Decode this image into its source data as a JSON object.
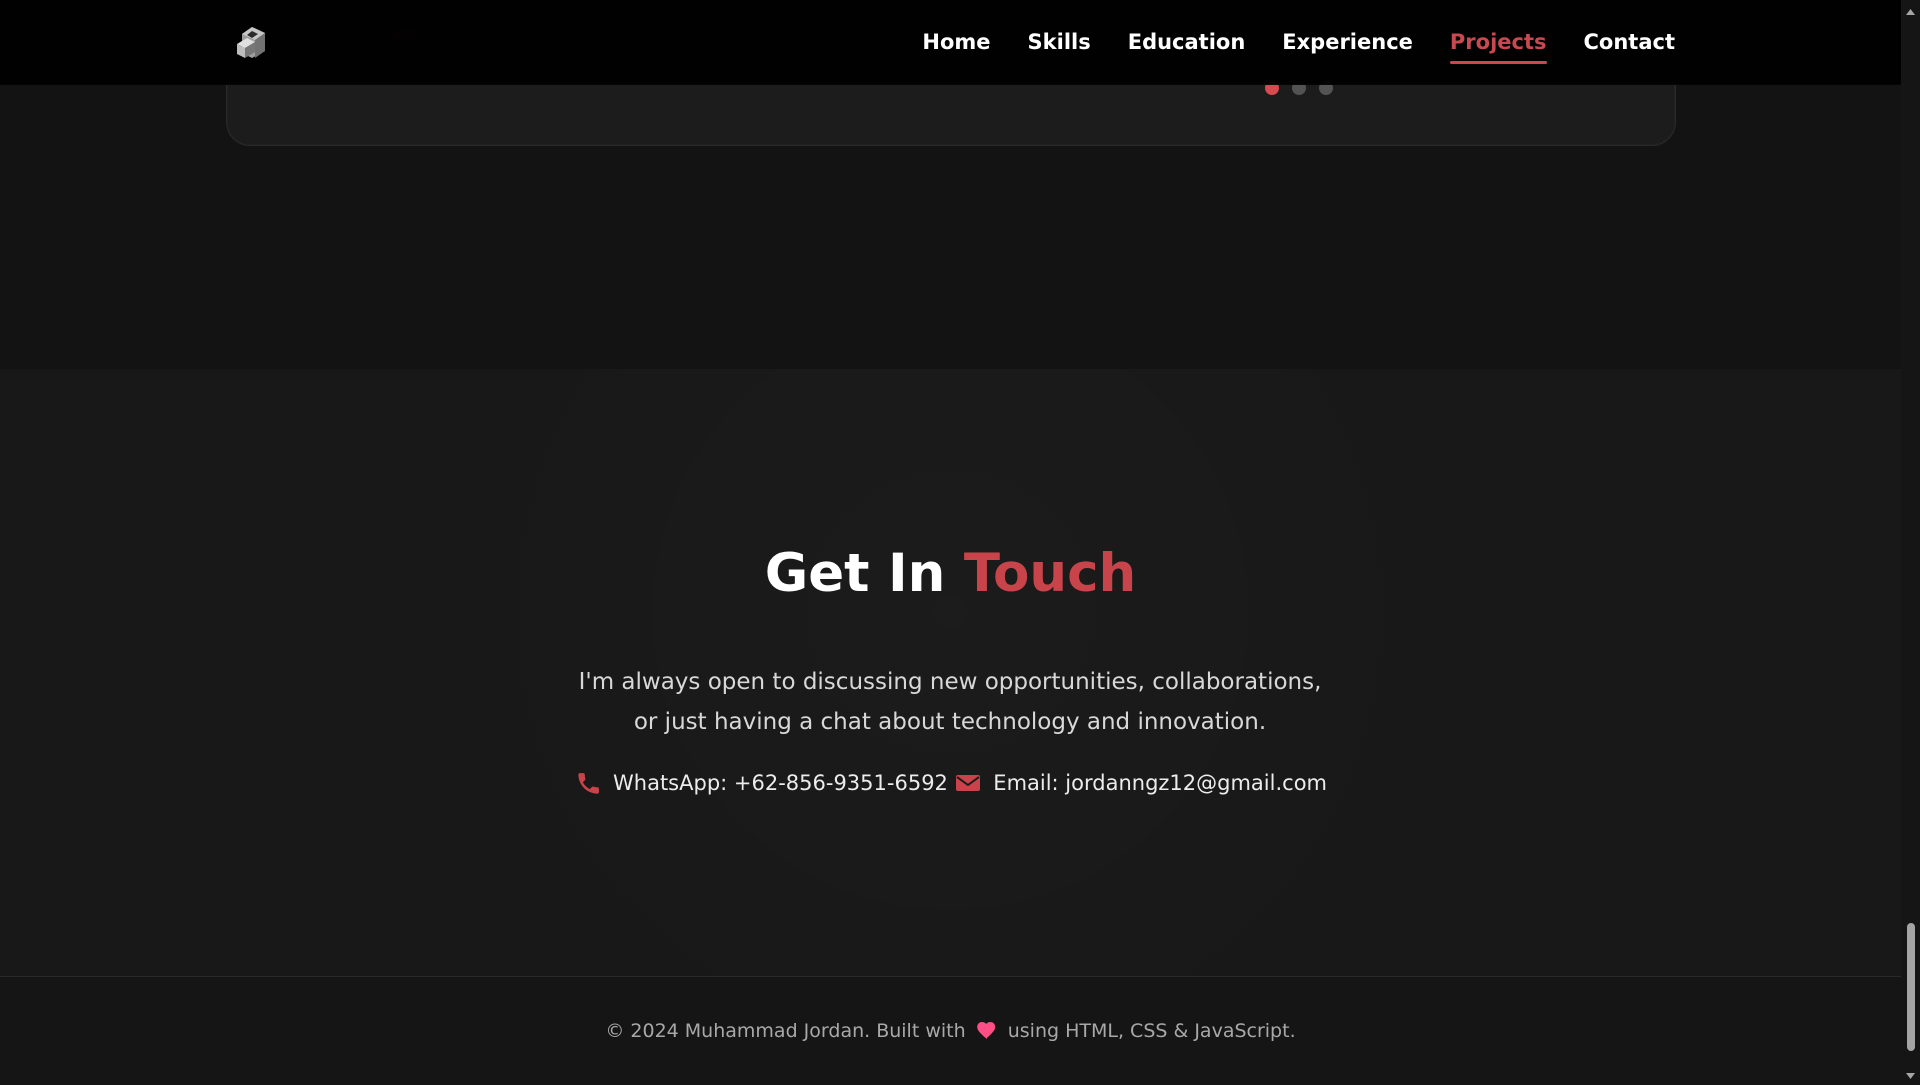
{
  "navigation": {
    "links": [
      {
        "label": "Home",
        "active": false
      },
      {
        "label": "Skills",
        "active": false
      },
      {
        "label": "Education",
        "active": false
      },
      {
        "label": "Experience",
        "active": false
      },
      {
        "label": "Projects",
        "active": true
      },
      {
        "label": "Contact",
        "active": false
      }
    ],
    "logo_icon": "stacked-monitor-logo"
  },
  "projects": {
    "carousel": {
      "active_dot": 1,
      "dot_count": 3
    }
  },
  "contact": {
    "title": {
      "prefix": "Get In",
      "accent": "Touch"
    },
    "description": "I'm always open to discussing new opportunities, collaborations, or just having a chat about technology and innovation.",
    "links": [
      {
        "icon": "phone-icon",
        "label": "WhatsApp: +62-856-9351-6592"
      },
      {
        "icon": "mail-icon",
        "label": "Email: jordanngz12@gmail.com"
      }
    ]
  },
  "footer": {
    "prefix": "© 2024 Muhammad Jordan. Built with",
    "heart_icon": "heart-icon",
    "suffix": "using HTML, CSS & JavaScript."
  },
  "colors": {
    "accent": "#c8444a",
    "background": "#181818",
    "nav_background": "#000000",
    "text": "#ffffff",
    "muted_text": "#a8a8a8"
  }
}
